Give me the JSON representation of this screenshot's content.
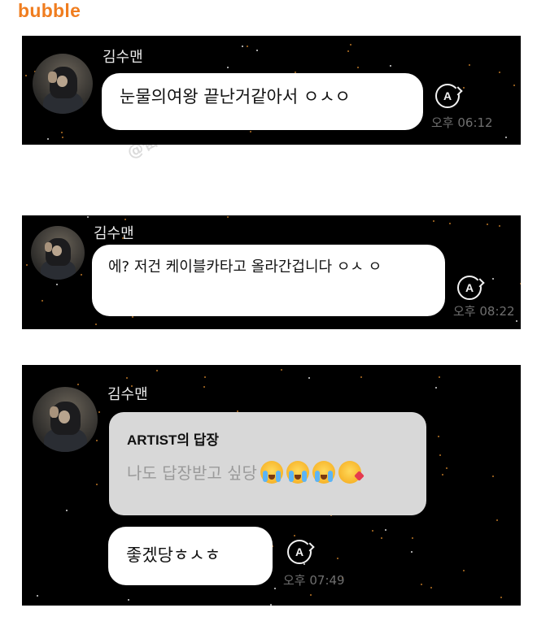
{
  "brand": "bubble",
  "watermark": "@奋斗在韩国 @奋斗在韩国 @",
  "messages": [
    {
      "sender": "김수맨",
      "text": "눈물의여왕 끝난거같아서 ㅇㅅㅇ",
      "time": "오후 06:12",
      "translate_icon": "A"
    },
    {
      "sender": "김수맨",
      "text": "에? 저건 케이블카타고 올라간겁니다 ㅇㅅ ㅇ",
      "time": "오후 08:22",
      "translate_icon": "A"
    },
    {
      "sender": "김수맨",
      "reply_title": "ARTIST의 답장",
      "reply_text": "나도 답장받고 싶당",
      "reply_emojis": [
        "loudly-crying-face-emoji",
        "loudly-crying-face-emoji",
        "loudly-crying-face-emoji",
        "face-blowing-kiss-emoji"
      ],
      "text": "좋겠당ㅎㅅㅎ",
      "time": "오후 07:49",
      "translate_icon": "A"
    }
  ],
  "colors": {
    "brand": "#f07d1f",
    "panel": "#000000",
    "bubble": "#ffffff",
    "reply_card": "#d8d8d8"
  }
}
